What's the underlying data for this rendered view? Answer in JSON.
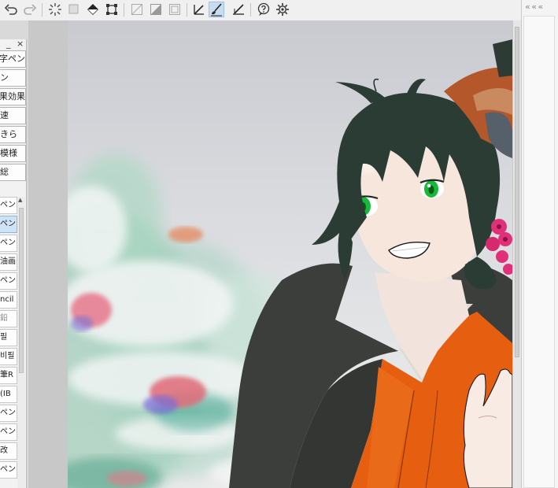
{
  "toolbar": {
    "buttons": [
      {
        "name": "undo",
        "icon": "undo-icon"
      },
      {
        "name": "redo",
        "icon": "redo-icon"
      },
      {
        "name": "clear-selection",
        "icon": "sparkle-icon"
      },
      {
        "name": "select-all",
        "icon": "selection-icon"
      },
      {
        "name": "fill",
        "icon": "bucket-icon"
      },
      {
        "name": "transform",
        "icon": "transform-icon"
      },
      {
        "name": "ruler-1",
        "icon": "ruler-icon"
      },
      {
        "name": "ruler-2",
        "icon": "gradient-icon"
      },
      {
        "name": "ruler-3",
        "icon": "frame-icon"
      },
      {
        "name": "pen-1",
        "icon": "pen-icon"
      },
      {
        "name": "pen-2",
        "icon": "brush-icon"
      },
      {
        "name": "pen-3",
        "icon": "pen-ruler-icon"
      },
      {
        "name": "help",
        "icon": "help-icon"
      },
      {
        "name": "settings",
        "icon": "gear-icon"
      }
    ]
  },
  "right_dock": {
    "chevrons": "« « «"
  },
  "palette": {
    "minimize_glyph": "_",
    "close_glyph": "×",
    "groups": [
      {
        "label": "字ペン"
      },
      {
        "label": "ン"
      },
      {
        "label": "果効果"
      },
      {
        "label": "速"
      },
      {
        "label": "きら"
      },
      {
        "label": "模様"
      },
      {
        "label": "総"
      }
    ],
    "tools": [
      {
        "label": "ペン",
        "selected": false,
        "gray": false
      },
      {
        "label": "ペン",
        "selected": true,
        "gray": false
      },
      {
        "label": "ペン",
        "selected": false,
        "gray": false
      },
      {
        "label": "油画",
        "selected": false,
        "gray": false
      },
      {
        "label": "ペン",
        "selected": false,
        "gray": false
      },
      {
        "label": "ncil",
        "selected": false,
        "gray": false
      },
      {
        "label": "鉛",
        "selected": false,
        "gray": true
      },
      {
        "label": "필",
        "selected": false,
        "gray": false
      },
      {
        "label": "비필",
        "selected": false,
        "gray": false
      },
      {
        "label": "筆R",
        "selected": false,
        "gray": false
      },
      {
        "label": "IB)",
        "selected": false,
        "gray": false
      },
      {
        "label": "ペン",
        "selected": false,
        "gray": false
      },
      {
        "label": "ペン",
        "selected": false,
        "gray": false
      },
      {
        "label": "改",
        "selected": false,
        "gray": false
      },
      {
        "label": "ペン",
        "selected": false,
        "gray": false
      }
    ]
  },
  "colors": {
    "hair": "#2a3c34",
    "eye": "#18b83a",
    "kimono": "#e65f10",
    "fur": "#3c3e3c",
    "skin": "#f7e6dc",
    "flower_pink": "#e0307a"
  }
}
